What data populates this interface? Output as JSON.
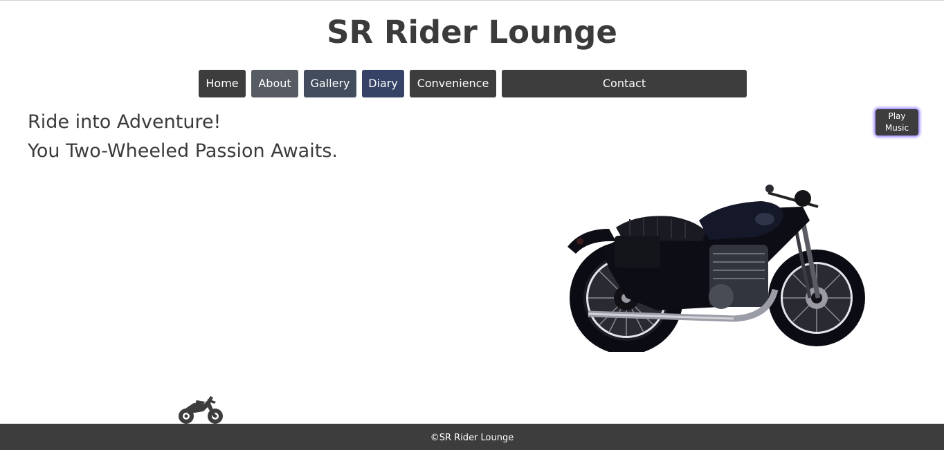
{
  "site": {
    "title": "SR Rider Lounge"
  },
  "nav": {
    "items": [
      {
        "label": "Home",
        "color": "#3d3d3d"
      },
      {
        "label": "About",
        "color": "#575b63"
      },
      {
        "label": "Gallery",
        "color": "#434c5d"
      },
      {
        "label": "Diary",
        "color": "#364366"
      },
      {
        "label": "Convenience",
        "color": "#3d3d3d"
      },
      {
        "label": "Contact",
        "color": "#3d3d3d"
      }
    ]
  },
  "hero": {
    "line1": "Ride into Adventure!",
    "line2": "You Two-Wheeled Passion Awaits."
  },
  "music": {
    "label": "Play Music",
    "glow_color": "#8a78ff"
  },
  "images": {
    "main": "motorcycle-photo",
    "small": "dirt-bike-icon"
  },
  "footer": {
    "text": "©SR Rider Lounge",
    "background": "#3d3d3d"
  }
}
